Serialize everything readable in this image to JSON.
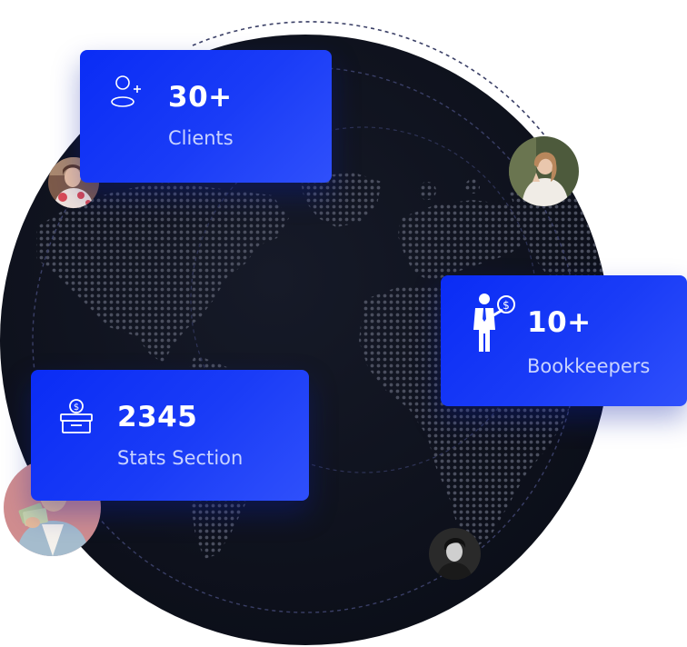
{
  "stats": [
    {
      "id": "clients",
      "value": "30+",
      "label": "Clients",
      "icon": "add-user-icon"
    },
    {
      "id": "bookkeepers",
      "value": "10+",
      "label": "Bookkeepers",
      "icon": "bookkeeper-icon"
    },
    {
      "id": "stats_section",
      "value": "2345",
      "label": "Stats Section",
      "icon": "donation-box-icon"
    }
  ],
  "colors": {
    "globe_bg": "#0e111c",
    "card_blue": "#1a3cf7",
    "label_text": "#c9d3ff",
    "orbit_line": "#3a3f66"
  },
  "avatars": [
    {
      "id": "avatar-woman-floral"
    },
    {
      "id": "avatar-woman-light-top"
    },
    {
      "id": "avatar-man-money"
    },
    {
      "id": "avatar-man-dark"
    }
  ]
}
